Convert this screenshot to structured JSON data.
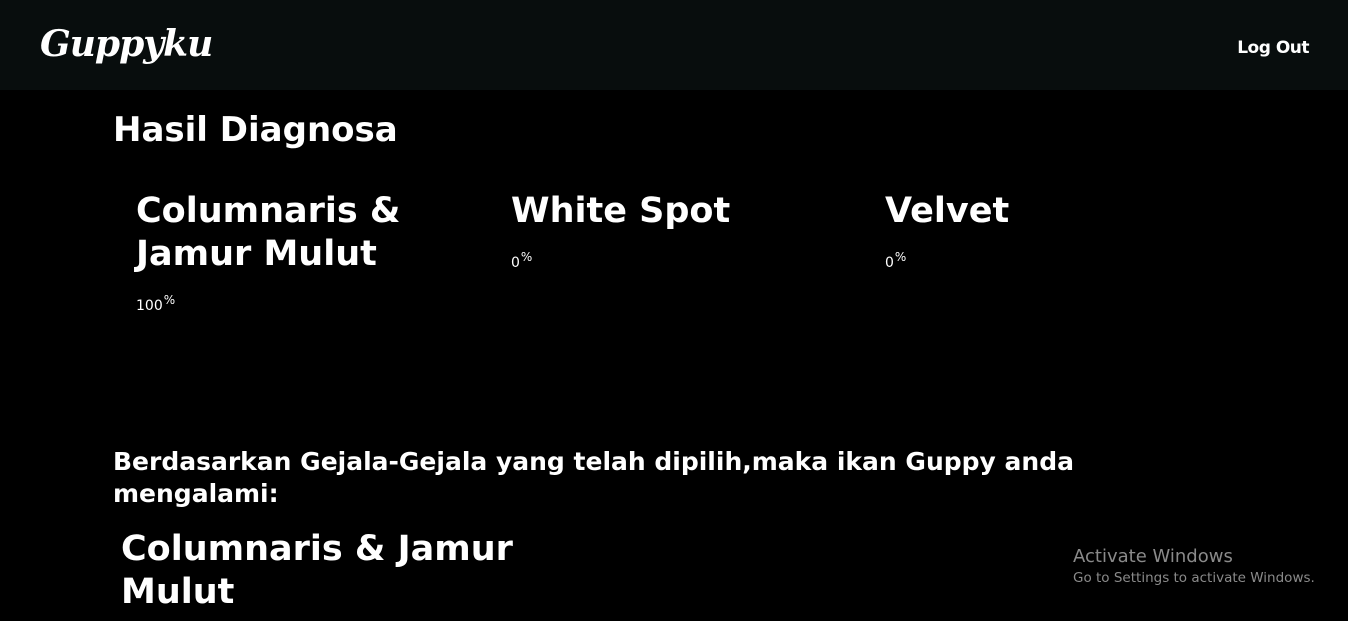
{
  "navbar": {
    "brand": "Guppyku",
    "logout_label": "Log Out"
  },
  "main": {
    "title": "Hasil Diagnosa",
    "diseases": [
      {
        "name": "Columnaris & Jamur Mulut",
        "percent": "100",
        "unit": "%"
      },
      {
        "name": "White Spot",
        "percent": "0",
        "unit": "%"
      },
      {
        "name": "Velvet",
        "percent": "0",
        "unit": "%"
      }
    ],
    "conclusion_text": "Berdasarkan Gejala-Gejala yang telah dipilih,maka ikan Guppy anda mengalami:",
    "result": "Columnaris & Jamur Mulut"
  },
  "watermark": {
    "title": "Activate Windows",
    "subtitle": "Go to Settings to activate Windows."
  }
}
